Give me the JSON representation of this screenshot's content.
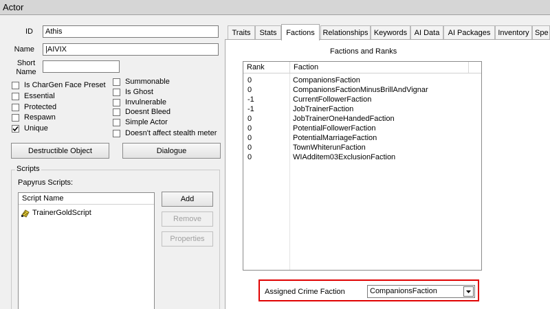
{
  "window": {
    "title": "Actor"
  },
  "fields": {
    "id_label": "ID",
    "id_value": "Athis",
    "name_label": "Name",
    "name_value": "|AIVIX",
    "short_name_label_1": "Short",
    "short_name_label_2": "Name",
    "short_name_value": ""
  },
  "checkboxes_left": [
    {
      "label": "Is CharGen Face Preset",
      "checked": false
    },
    {
      "label": "Essential",
      "checked": false
    },
    {
      "label": "Protected",
      "checked": false
    },
    {
      "label": "Respawn",
      "checked": false
    },
    {
      "label": "Unique",
      "checked": true
    }
  ],
  "checkboxes_right": [
    {
      "label": "Summonable",
      "checked": false
    },
    {
      "label": "Is Ghost",
      "checked": false
    },
    {
      "label": "Invulnerable",
      "checked": false
    },
    {
      "label": "Doesnt Bleed",
      "checked": false
    },
    {
      "label": "Simple Actor",
      "checked": false
    },
    {
      "label": "Doesn't affect stealth meter",
      "checked": false
    }
  ],
  "buttons": {
    "destructible": "Destructible Object",
    "dialogue": "Dialogue"
  },
  "scripts": {
    "group_title": "Scripts",
    "papyrus_label": "Papyrus Scripts:",
    "column": "Script Name",
    "items": [
      "TrainerGoldScript"
    ],
    "add": "Add",
    "remove": "Remove",
    "properties": "Properties"
  },
  "tabs": [
    "Traits",
    "Stats",
    "Factions",
    "Relationships",
    "Keywords",
    "AI Data",
    "AI Packages",
    "Inventory",
    "Spe"
  ],
  "active_tab": "Factions",
  "factions": {
    "section_title": "Factions and Ranks",
    "columns": {
      "rank": "Rank",
      "faction": "Faction"
    },
    "rows": [
      {
        "rank": "0",
        "faction": "CompanionsFaction"
      },
      {
        "rank": "0",
        "faction": "CompanionsFactionMinusBrillAndVignar"
      },
      {
        "rank": "-1",
        "faction": "CurrentFollowerFaction"
      },
      {
        "rank": "-1",
        "faction": "JobTrainerFaction"
      },
      {
        "rank": "0",
        "faction": "JobTrainerOneHandedFaction"
      },
      {
        "rank": "0",
        "faction": "PotentialFollowerFaction"
      },
      {
        "rank": "0",
        "faction": "PotentialMarriageFaction"
      },
      {
        "rank": "0",
        "faction": "TownWhiterunFaction"
      },
      {
        "rank": "0",
        "faction": "WIAdditem03ExclusionFaction"
      }
    ]
  },
  "crime": {
    "label": "Assigned Crime Faction",
    "value": "CompanionsFaction"
  },
  "icons": {
    "script": "script-scroll-icon",
    "dropdown": "chevron-down-icon",
    "check": "checkmark-icon"
  },
  "colors": {
    "highlight": "#e00000",
    "window_bg": "#f0f0f0"
  }
}
